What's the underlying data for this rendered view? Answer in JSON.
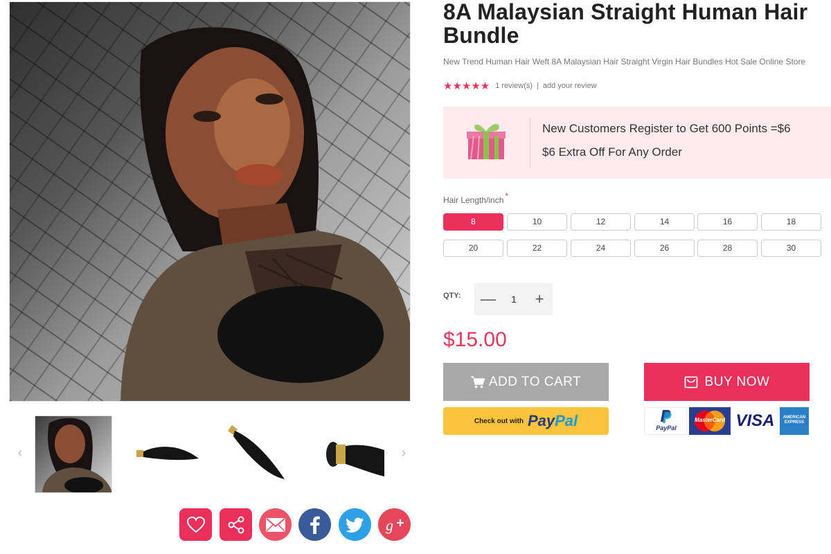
{
  "product": {
    "title": "8A Malaysian Straight Human Hair Bundle",
    "subtitle": "New Trend Human Hair Weft 8A Malaysian Hair Straight Virgin Hair Bundles Hot Sale Online Store",
    "stars": "★★★★★",
    "review_count": "1 review(s)",
    "review_separator": "|",
    "add_review": "add your review",
    "price": "$15.00"
  },
  "promo": {
    "line1": "New Customers Register to Get 600 Points =$6",
    "line2": "$6 Extra Off For Any Order"
  },
  "options": {
    "length_label": "Hair Length/inch",
    "required_mark": "*",
    "lengths": [
      "8",
      "10",
      "12",
      "14",
      "16",
      "18",
      "20",
      "22",
      "24",
      "26",
      "28",
      "30"
    ],
    "selected_length": "8"
  },
  "quantity": {
    "label": "QTY:",
    "value": "1",
    "minus": "—",
    "plus": "+"
  },
  "actions": {
    "add_to_cart": "ADD TO CART",
    "buy_now": "BUY NOW",
    "paypal_prefix": "Check out with",
    "paypal_pay": "Pay",
    "paypal_pal": "Pal"
  },
  "payment_logos": {
    "paypal": "PayPal",
    "mastercard": "MasterCard",
    "visa": "VISA",
    "amex": "AMERICAN EXPRESS"
  },
  "gallery": {
    "prev_arrow": "‹",
    "next_arrow": "›"
  },
  "colors": {
    "accent": "#ea2f5d",
    "price": "#e6365e",
    "cart_button": "#a8a8a8",
    "paypal_yellow": "#fcc43a",
    "promo_bg": "#fdeaee"
  },
  "icons": {
    "wishlist": "heart-icon",
    "share": "share-icon",
    "email": "envelope-icon",
    "facebook": "facebook-icon",
    "twitter": "twitter-icon",
    "googleplus": "google-plus-icon",
    "cart": "cart-icon",
    "buy": "bag-icon",
    "gift": "gift-icon"
  }
}
